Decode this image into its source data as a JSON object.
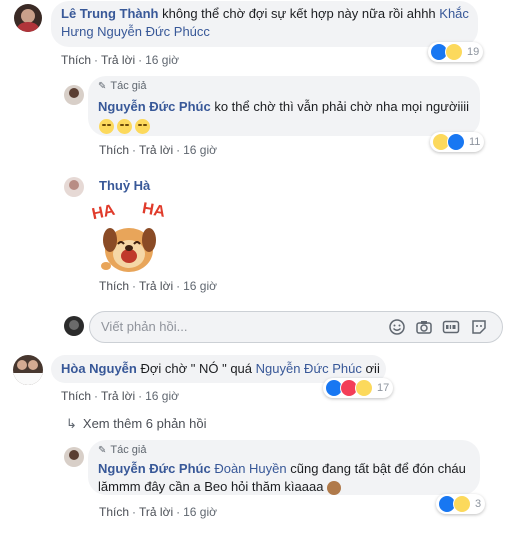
{
  "comments": [
    {
      "author": "Lê Trung Thành",
      "text": "không thể chờ đợi sự kết hợp này nữa rồi ahhh",
      "mention_line1": "Khắc",
      "mention_line2": "Hưng Nguyễn Đức Phúcc",
      "like": "Thích",
      "reply": "Trả lời",
      "time": "16 giờ",
      "reaction_count": "19"
    },
    {
      "author_tag": "Tác giả",
      "author": "Nguyễn Đức Phúc",
      "text": "ko thể chờ thì vẫn phải chờ nha mọi ngườiiii",
      "like": "Thích",
      "reply": "Trả lời",
      "time": "16 giờ",
      "reaction_count": "11"
    },
    {
      "author": "Thuỷ Hà",
      "sticker_text_left": "HA",
      "sticker_text_right": "HA",
      "like": "Thích",
      "reply": "Trả lời",
      "time": "16 giờ"
    },
    {
      "author": "Hòa Nguyễn",
      "text": "Đợi chờ \" NÓ \" quá",
      "mention": "Nguyễn Đức Phúc",
      "text_end": "ơii",
      "like": "Thích",
      "reply": "Trả lời",
      "time": "16 giờ",
      "reaction_count": "17"
    },
    {
      "author_tag": "Tác giả",
      "author": "Nguyễn Đức Phúc",
      "mention": "Đoàn Huyền",
      "text_line1": "cũng đang tất bật để đón cháu",
      "text_line2": "lămmm đây cần a Beo hỏi thăm kìaaaa",
      "like": "Thích",
      "reply": "Trả lời",
      "time": "16 giờ",
      "reaction_count": "3"
    }
  ],
  "reply_input": {
    "placeholder": "Viết phản hồi..."
  },
  "view_more": "Xem thêm 6 phản hồi",
  "colors": {
    "link": "#385898",
    "bubble": "#f2f3f5",
    "like": "#1877f2",
    "haha": "#fcd95c",
    "love": "#f33e58"
  }
}
